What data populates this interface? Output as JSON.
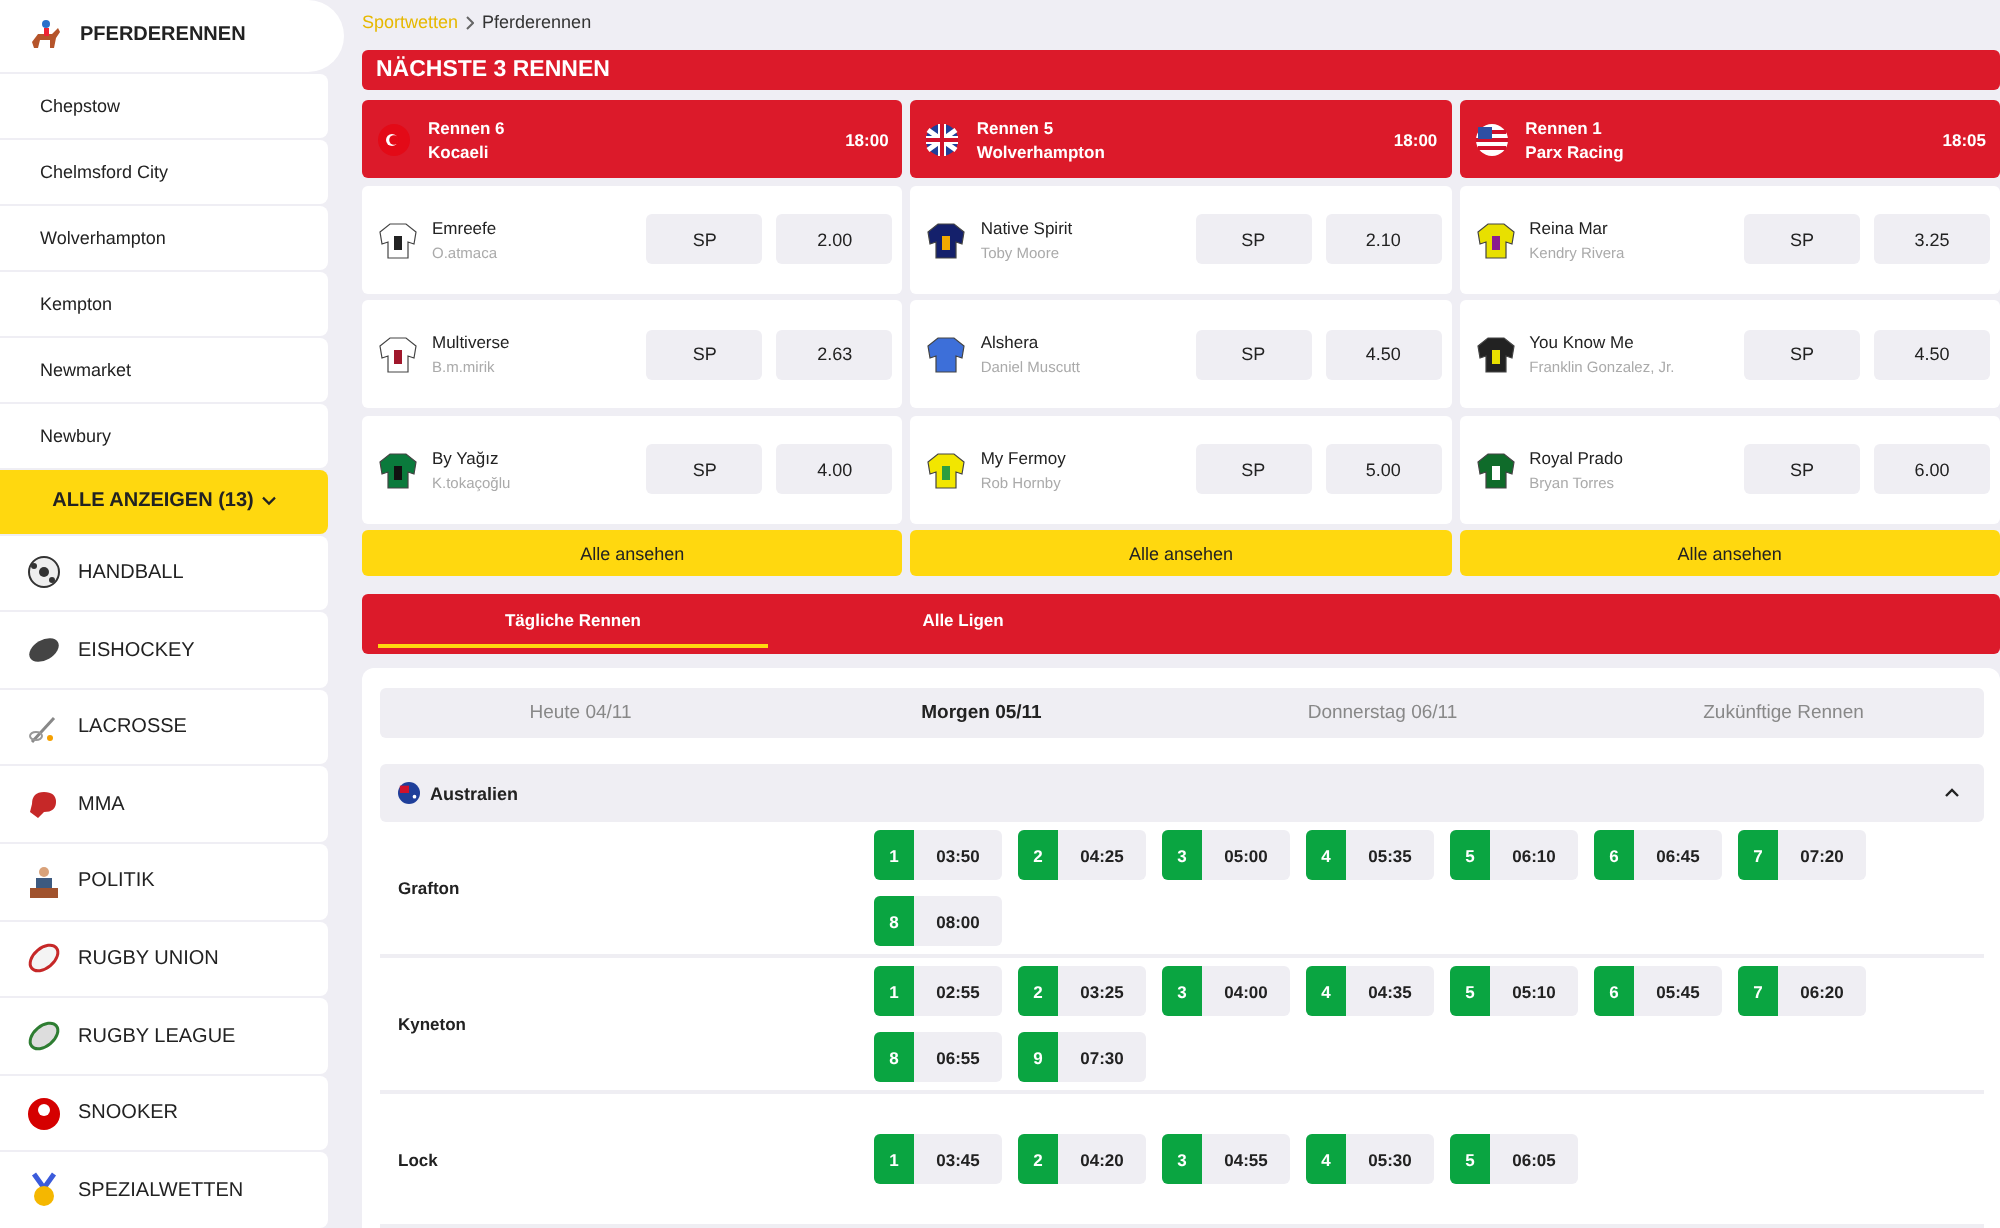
{
  "sidebar": {
    "header": {
      "label": "PFERDERENNEN"
    },
    "tracks": [
      "Chepstow",
      "Chelmsford City",
      "Wolverhampton",
      "Kempton",
      "Newmarket",
      "Newbury"
    ],
    "show_all": "ALLE ANZEIGEN (13)",
    "sports": [
      "HANDBALL",
      "EISHOCKEY",
      "LACROSSE",
      "MMA",
      "POLITIK",
      "RUGBY UNION",
      "RUGBY LEAGUE",
      "SNOOKER",
      "SPEZIALWETTEN"
    ]
  },
  "breadcrumb": [
    {
      "label": "Sportwetten",
      "kind": "link"
    },
    {
      "label": "Pferderennen",
      "kind": "current"
    }
  ],
  "next_races": {
    "title": "NÄCHSTE 3 RENNEN",
    "cards": [
      {
        "race": "Rennen 6",
        "track": "Kocaeli",
        "time": "18:00",
        "runners": [
          {
            "horse": "Emreefe",
            "jockey": "O.atmaca",
            "sp": "SP",
            "odds": "2.00"
          },
          {
            "horse": "Multiverse",
            "jockey": "B.m.mirik",
            "sp": "SP",
            "odds": "2.63"
          },
          {
            "horse": "By Yağız",
            "jockey": "K.tokaçoğlu",
            "sp": "SP",
            "odds": "4.00"
          }
        ],
        "button": "Alle ansehen"
      },
      {
        "race": "Rennen 5",
        "track": "Wolverhampton",
        "time": "18:00",
        "runners": [
          {
            "horse": "Native Spirit",
            "jockey": "Toby Moore",
            "sp": "SP",
            "odds": "2.10"
          },
          {
            "horse": "Alshera",
            "jockey": "Daniel Muscutt",
            "sp": "SP",
            "odds": "4.50"
          },
          {
            "horse": "My Fermoy",
            "jockey": "Rob Hornby",
            "sp": "SP",
            "odds": "5.00"
          }
        ],
        "button": "Alle ansehen"
      },
      {
        "race": "Rennen 1",
        "track": "Parx Racing",
        "time": "18:05",
        "runners": [
          {
            "horse": "Reina Mar",
            "jockey": "Kendry Rivera",
            "sp": "SP",
            "odds": "3.25"
          },
          {
            "horse": "You Know Me",
            "jockey": "Franklin Gonzalez, Jr.",
            "sp": "SP",
            "odds": "4.50"
          },
          {
            "horse": "Royal Prado",
            "jockey": "Bryan Torres",
            "sp": "SP",
            "odds": "6.00"
          }
        ],
        "button": "Alle ansehen"
      }
    ]
  },
  "tabs": [
    {
      "label": "Tägliche Rennen",
      "selected": true
    },
    {
      "label": "Alle Ligen",
      "selected": false
    }
  ],
  "days": [
    {
      "label": "Heute 04/11",
      "selected": false
    },
    {
      "label": "Morgen 05/11",
      "selected": true
    },
    {
      "label": "Donnerstag 06/11",
      "selected": false
    },
    {
      "label": "Zukünftige Rennen",
      "selected": false
    }
  ],
  "regions": [
    {
      "name": "Australien",
      "expanded": true,
      "meetings": [
        {
          "track": "Grafton",
          "races": [
            {
              "number": "1",
              "time": "03:50"
            },
            {
              "number": "2",
              "time": "04:25"
            },
            {
              "number": "3",
              "time": "05:00"
            },
            {
              "number": "4",
              "time": "05:35"
            },
            {
              "number": "5",
              "time": "06:10"
            },
            {
              "number": "6",
              "time": "06:45"
            },
            {
              "number": "7",
              "time": "07:20"
            },
            {
              "number": "8",
              "time": "08:00"
            }
          ]
        },
        {
          "track": "Kyneton",
          "races": [
            {
              "number": "1",
              "time": "02:55"
            },
            {
              "number": "2",
              "time": "03:25"
            },
            {
              "number": "3",
              "time": "04:00"
            },
            {
              "number": "4",
              "time": "04:35"
            },
            {
              "number": "5",
              "time": "05:10"
            },
            {
              "number": "6",
              "time": "05:45"
            },
            {
              "number": "7",
              "time": "06:20"
            },
            {
              "number": "8",
              "time": "06:55"
            },
            {
              "number": "9",
              "time": "07:30"
            }
          ]
        },
        {
          "track": "Lock",
          "races": [
            {
              "number": "1",
              "time": "03:45"
            },
            {
              "number": "2",
              "time": "04:20"
            },
            {
              "number": "3",
              "time": "04:55"
            },
            {
              "number": "4",
              "time": "05:30"
            },
            {
              "number": "5",
              "time": "06:05"
            }
          ]
        }
      ]
    }
  ]
}
